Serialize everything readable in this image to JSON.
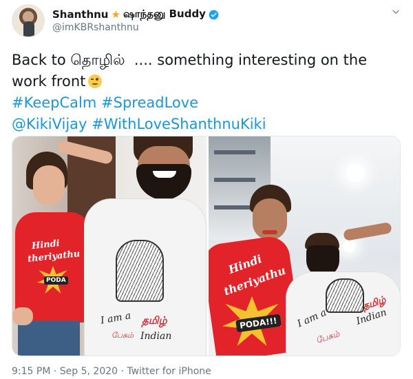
{
  "author": {
    "name": "Shanthnu",
    "name_suffix": "ஷாந்தனு Buddy",
    "handle": "@imKBRshanthnu"
  },
  "tweet": {
    "line1_prefix": "Back to ",
    "line1_tamil": "தொழில்",
    "line1_rest": "  .... something interesting on the",
    "line2": "work front",
    "hashtag1": "#KeepCalm",
    "hashtag2": "#SpreadLove",
    "mention": "@KikiVijay",
    "hashtag3": "#WithLoveShanthnuKiki"
  },
  "photos": {
    "left": {
      "red_shirt_text1": "Hindi",
      "red_shirt_text2": "theriyathu",
      "red_shirt_badge": "PODA",
      "white_shirt_line1": "I am a",
      "white_shirt_tamil": "தமிழ்",
      "white_shirt_tamil2": "பேசும்",
      "white_shirt_line2": "Indian"
    },
    "right": {
      "red_shirt_text1": "Hindi",
      "red_shirt_text2": "theriyathu",
      "red_shirt_badge": "PODA!!!",
      "white_shirt_line1": "I am a",
      "white_shirt_tamil": "தமிழ்",
      "white_shirt_line2": "Indian",
      "white_shirt_tamil2": "பேசும்"
    }
  },
  "footer": {
    "time": "9:15 PM",
    "separator1": " · ",
    "date": "Sep 5, 2020",
    "separator2": " · ",
    "source": "Twitter for iPhone"
  },
  "colors": {
    "link": "#1b95e0",
    "verified": "#1da1f2",
    "muted": "#657786"
  },
  "icons": {
    "star": "star-emoji-icon",
    "verified": "verified-badge-icon",
    "caret": "chevron-down-icon",
    "emoji": "winking-face-icon"
  }
}
